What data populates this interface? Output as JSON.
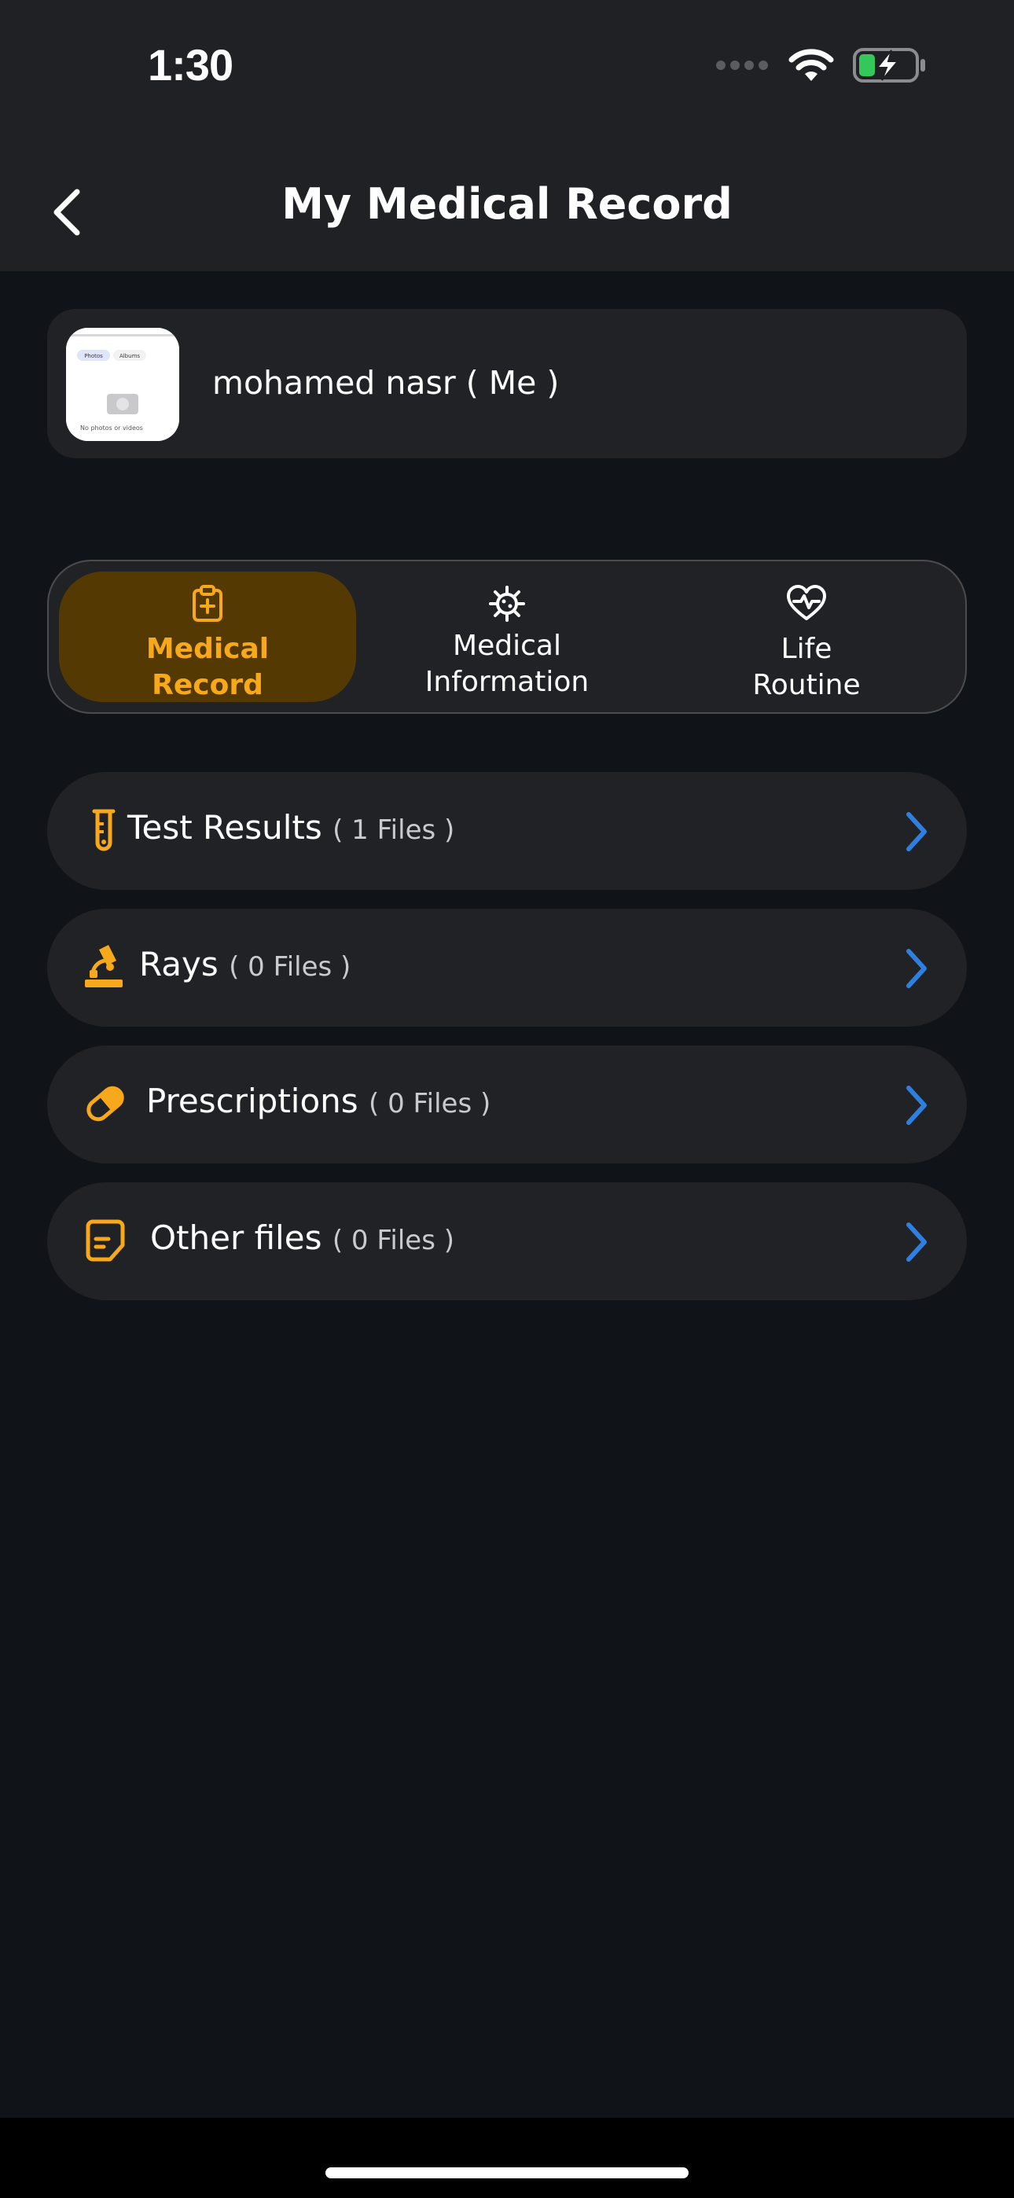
{
  "status": {
    "time": "1:30"
  },
  "header": {
    "title": "My Medical Record"
  },
  "profile": {
    "name": "mohamed nasr ( Me )",
    "avatar_thumb": {
      "tabs": [
        "Photos",
        "Albums"
      ],
      "caption": "No photos or videos"
    }
  },
  "tabs": [
    {
      "label_line1": "Medical",
      "label_line2": "Record",
      "icon": "clipboard-plus-icon",
      "active": true
    },
    {
      "label_line1": "Medical",
      "label_line2": "Information",
      "icon": "virus-icon",
      "active": false
    },
    {
      "label_line1": "Life",
      "label_line2": "Routine",
      "icon": "heart-pulse-icon",
      "active": false
    }
  ],
  "records": [
    {
      "title": "Test Results",
      "count": "( 1 Files )",
      "icon": "test-tube-icon"
    },
    {
      "title": "Rays",
      "count": "( 0 Files )",
      "icon": "microscope-icon"
    },
    {
      "title": "Prescriptions",
      "count": "( 0 Files )",
      "icon": "pill-icon"
    },
    {
      "title": "Other files",
      "count": "( 0 Files )",
      "icon": "document-icon"
    }
  ],
  "colors": {
    "accent": "#f7a81b",
    "active_tab_bg": "#543a02",
    "chevron": "#2f7fe0",
    "card_bg": "#202226",
    "page_bg": "#101317"
  }
}
